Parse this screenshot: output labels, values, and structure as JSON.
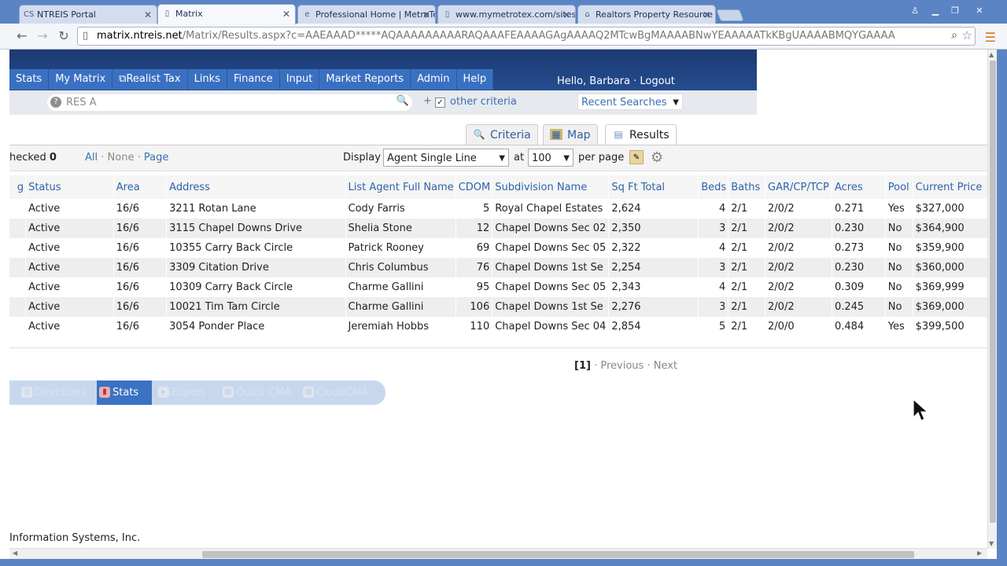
{
  "browser": {
    "tabs": [
      {
        "label": "NTREIS Portal",
        "icon": "cs-logo-icon"
      },
      {
        "label": "Matrix",
        "icon": "page-icon"
      },
      {
        "label": "Professional Home | MetroTe",
        "icon": "ie-icon"
      },
      {
        "label": "www.mymetrotex.com/sites/",
        "icon": "page-icon"
      },
      {
        "label": "Realtors Property Resource",
        "icon": "rpr-icon"
      }
    ],
    "url_host": "matrix.ntreis.net",
    "url_rest": "/Matrix/Results.aspx?c=AAEAAAD*****AQAAAAAAAAARAQAAAFEAAAAGAgAAAAQ2MTcwBgMAAAABNwYEAAAAATkKBgUAAAABMQYGAAAA"
  },
  "nav": {
    "items": [
      "Stats",
      "My Matrix",
      "Realist Tax",
      "Links",
      "Finance",
      "Input",
      "Market Reports",
      "Admin",
      "Help"
    ],
    "greeting": "Hello, Barbara · Logout"
  },
  "search": {
    "value": "RES A",
    "other_criteria": "other criteria",
    "recent_searches": "Recent Searches"
  },
  "view_tabs": [
    "Criteria",
    "Map",
    "Results"
  ],
  "toolbar": {
    "checked_label": "hecked",
    "checked_count": "0",
    "all": "All",
    "sep1": " · ",
    "none": "None",
    "sep2": " · ",
    "page": "Page",
    "display_label": "Display",
    "display_value": "Agent Single Line",
    "at_label": "at",
    "per_page_value": "100",
    "per_page_label": "per page"
  },
  "table": {
    "columns": [
      "g",
      "Status",
      "Area",
      "Address",
      "List Agent Full Name",
      "CDOM",
      "Subdivision Name",
      "Sq Ft Total",
      "Beds",
      "Baths",
      "GAR/CP/TCP",
      "Acres",
      "Pool",
      "Current Price"
    ],
    "rows": [
      [
        "Active",
        "16/6",
        "3211 Rotan Lane",
        "Cody Farris",
        "5",
        "Royal Chapel Estates",
        "2,624",
        "4",
        "2/1",
        "2/0/2",
        "0.271",
        "Yes",
        "$327,000"
      ],
      [
        "Active",
        "16/6",
        "3115 Chapel Downs Drive",
        "Shelia Stone",
        "12",
        "Chapel Downs Sec 02",
        "2,350",
        "3",
        "2/1",
        "2/0/2",
        "0.230",
        "No",
        "$364,900"
      ],
      [
        "Active",
        "16/6",
        "10355 Carry Back Circle",
        "Patrick Rooney",
        "69",
        "Chapel Downs Sec 05",
        "2,322",
        "4",
        "2/1",
        "2/0/2",
        "0.273",
        "No",
        "$359,900"
      ],
      [
        "Active",
        "16/6",
        "3309 Citation Drive",
        "Chris Columbus",
        "76",
        "Chapel Downs 1st Se",
        "2,254",
        "3",
        "2/1",
        "2/0/2",
        "0.230",
        "No",
        "$360,000"
      ],
      [
        "Active",
        "16/6",
        "10309 Carry Back Circle",
        "Charme Gallini",
        "95",
        "Chapel Downs Sec 05",
        "2,343",
        "4",
        "2/1",
        "2/0/2",
        "0.309",
        "No",
        "$369,999"
      ],
      [
        "Active",
        "16/6",
        "10021 Tim Tam Circle",
        "Charme Gallini",
        "106",
        "Chapel Downs 1st Se",
        "2,276",
        "3",
        "2/1",
        "2/0/2",
        "0.245",
        "No",
        "$369,000"
      ],
      [
        "Active",
        "16/6",
        "3054 Ponder Place",
        "Jeremiah Hobbs",
        "110",
        "Chapel Downs Sec 04",
        "2,854",
        "5",
        "2/1",
        "2/0/0",
        "0.484",
        "Yes",
        "$399,500"
      ]
    ]
  },
  "pager": {
    "current": "[1]",
    "sep1": " · ",
    "previous": "Previous",
    "sep2": " · ",
    "next": "Next"
  },
  "actions": [
    "Directions",
    "Stats",
    "Export",
    "Quick CMA",
    "CloudCMA"
  ],
  "footer": "Information Systems, Inc."
}
